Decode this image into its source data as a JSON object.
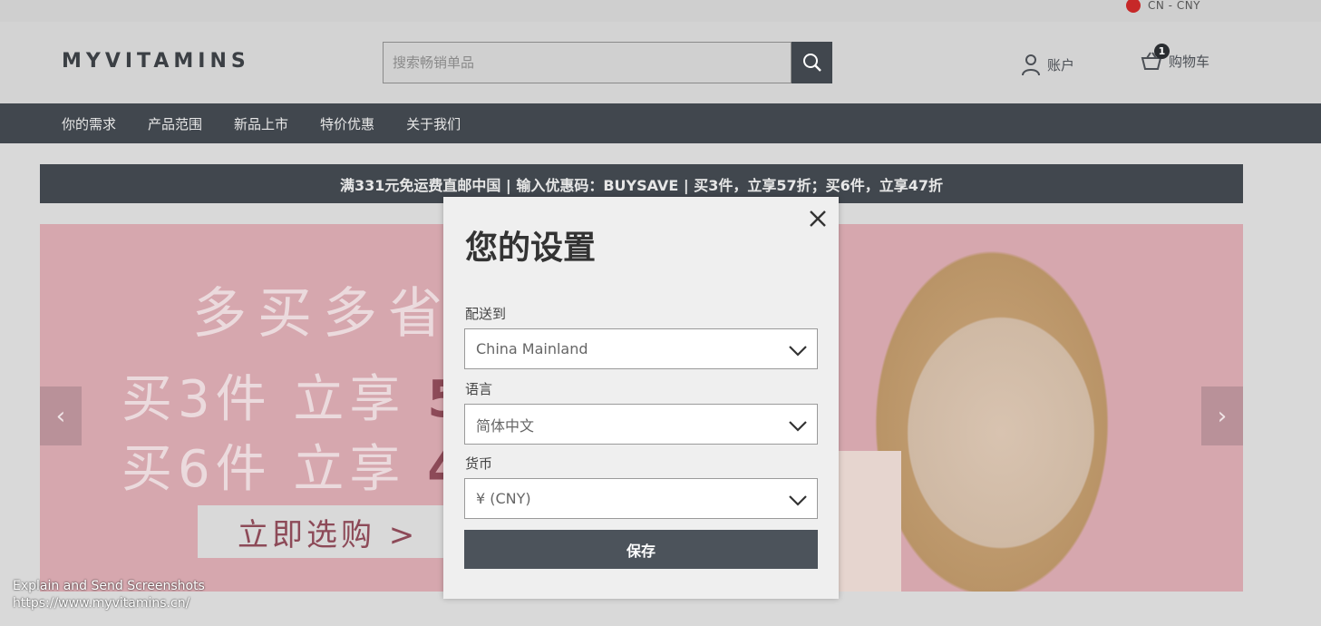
{
  "topbar": {
    "locale": "CN - CNY"
  },
  "header": {
    "logo": "MYVITAMINS",
    "search_placeholder": "搜索畅销单品",
    "account_label": "账户",
    "cart_label": "购物车",
    "cart_count": "1"
  },
  "nav": {
    "items": [
      "你的需求",
      "产品范围",
      "新品上市",
      "特价优惠",
      "关于我们"
    ]
  },
  "promo": {
    "text": "满331元免运费直邮中国 | 输入优惠码：BUYSAVE | 买3件，立享57折；买6件，立享47折"
  },
  "hero": {
    "line1": "多买多省",
    "line2_prefix": "买3件 立享",
    "line2_highlight": "5",
    "line3_prefix": "买6件 立享",
    "line3_highlight": "4",
    "cta": "立即选购 >",
    "prev": "‹",
    "next": "›"
  },
  "modal": {
    "title": "您的设置",
    "ship_label": "配送到",
    "ship_value": "China Mainland",
    "lang_label": "语言",
    "lang_value": "简体中文",
    "currency_label": "货币",
    "currency_value": "¥ (CNY)",
    "save_label": "保存"
  },
  "overlay": {
    "line1": "Explain and Send Screenshots",
    "line2": "https://www.myvitamins.cn/"
  },
  "colors": {
    "nav_bg": "#41474e",
    "hero_bg": "#d6a7ae",
    "accent": "#8d4a58"
  }
}
